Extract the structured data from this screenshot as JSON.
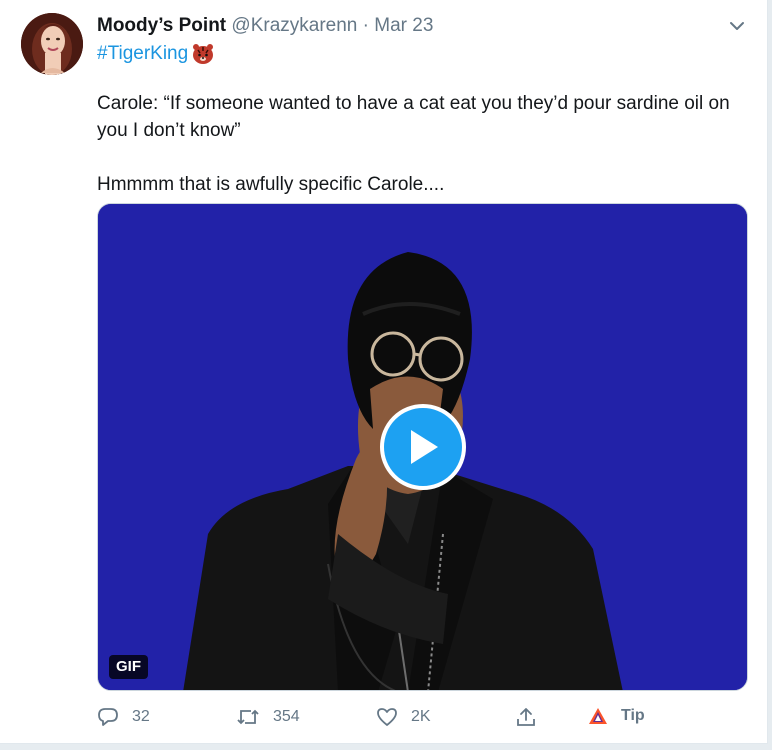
{
  "tweet": {
    "display_name": "Moody’s Point",
    "handle": "@Krazykarenn",
    "separator": "·",
    "date": "Mar 23",
    "hashtag": "#TigerKing",
    "hashtag_emoji": "tiger-face-icon",
    "body": [
      "Carole: “If someone wanted to have a cat eat you they’d pour sardine oil on you I don’t know”",
      "Hmmmm that is awfully specific Carole...."
    ]
  },
  "media": {
    "type": "gif",
    "badge": "GIF",
    "background_color": "#2222a8",
    "play_icon": "play-icon"
  },
  "actions": {
    "reply_count": "32",
    "retweet_count": "354",
    "like_count": "2K",
    "tip_label": "Tip"
  },
  "colors": {
    "accent": "#1da1f2",
    "link": "#1b95e0",
    "muted_text": "#657786",
    "text": "#14171a"
  }
}
